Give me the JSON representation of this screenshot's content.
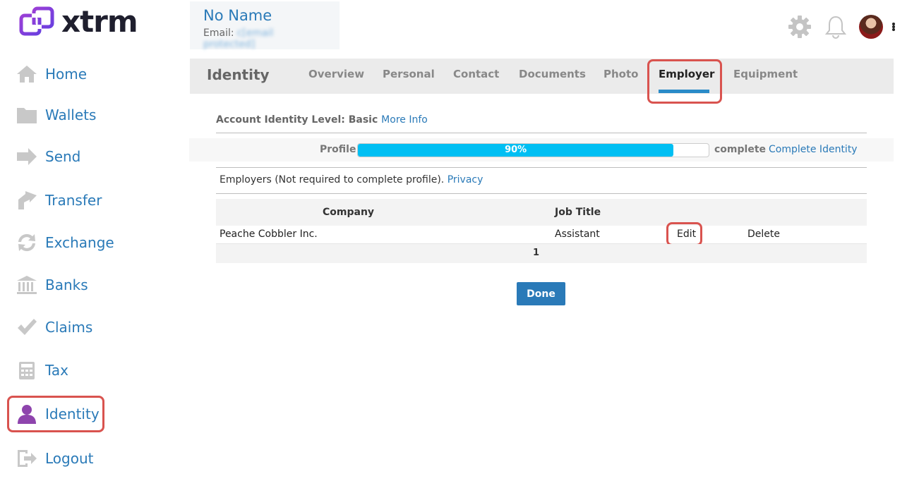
{
  "logo": {
    "text": "xtrm"
  },
  "sidebar": {
    "items": [
      {
        "label": "Home",
        "icon": "home-icon"
      },
      {
        "label": "Wallets",
        "icon": "folder-icon"
      },
      {
        "label": "Send",
        "icon": "arrow-right-icon"
      },
      {
        "label": "Transfer",
        "icon": "transfer-arrow-icon"
      },
      {
        "label": "Exchange",
        "icon": "exchange-icon"
      },
      {
        "label": "Banks",
        "icon": "bank-icon"
      },
      {
        "label": "Claims",
        "icon": "checkmark-icon"
      },
      {
        "label": "Tax",
        "icon": "calculator-icon"
      },
      {
        "label": "Identity",
        "icon": "person-icon",
        "active": true
      },
      {
        "label": "Logout",
        "icon": "logout-icon"
      }
    ]
  },
  "user": {
    "name": "No Name",
    "email_label": "Email:",
    "email_value": "c[email protected]"
  },
  "header": {
    "icons": [
      "gear-icon",
      "bell-icon",
      "avatar",
      "kebab-menu-icon"
    ]
  },
  "tabs": {
    "section_title": "Identity",
    "items": [
      {
        "label": "Overview"
      },
      {
        "label": "Personal"
      },
      {
        "label": "Contact"
      },
      {
        "label": "Documents"
      },
      {
        "label": "Photo"
      },
      {
        "label": "Employer",
        "active": true
      },
      {
        "label": "Equipment"
      }
    ]
  },
  "identity": {
    "level_label": "Account Identity Level: Basic",
    "more_info": "More Info",
    "profile_label": "Profile",
    "progress_percent": 90,
    "progress_text": "90%",
    "complete_text": "complete",
    "complete_link": "Complete Identity"
  },
  "employers": {
    "note": "Employers (Not required to complete profile).",
    "privacy_link": "Privacy",
    "columns": {
      "company": "Company",
      "job_title": "Job Title"
    },
    "rows": [
      {
        "company": "Peache Cobbler Inc.",
        "job_title": "Assistant",
        "edit": "Edit",
        "delete": "Delete"
      }
    ],
    "page": "1",
    "done_label": "Done"
  },
  "colors": {
    "link": "#2a7ab8",
    "progress": "#00bff3",
    "highlight": "#d9534f",
    "identity_icon": "#8e44ad"
  }
}
